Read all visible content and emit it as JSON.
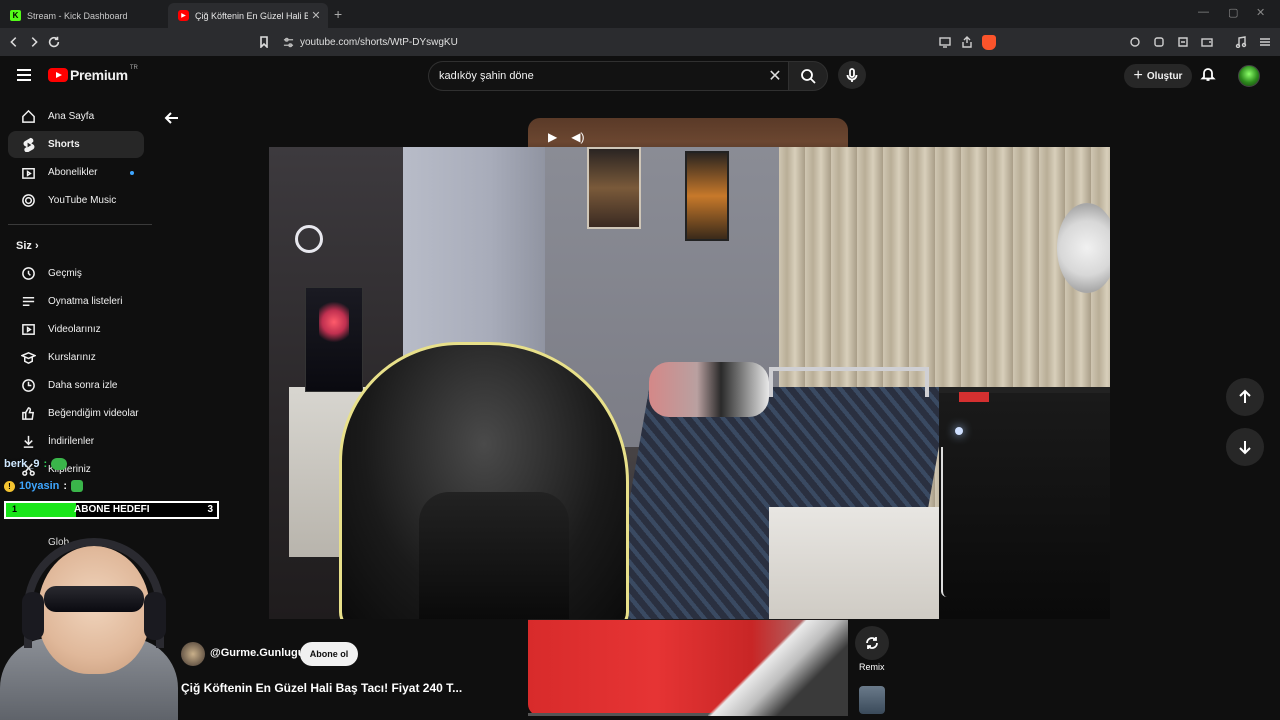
{
  "browser": {
    "tabs": [
      {
        "title": "Stream - Kick Dashboard",
        "favicon": "kick-icon"
      },
      {
        "title": "Çiğ Köftenin En Güzel Hali Baş Taci",
        "favicon": "youtube-icon"
      }
    ],
    "url": "youtube.com/shorts/WtP-DYswgKU"
  },
  "masthead": {
    "logo_text": "Premium",
    "country_code": "TR",
    "search_value": "kadıköy şahin döne",
    "create_label": "Oluştur"
  },
  "sidebar": {
    "main": [
      {
        "label": "Ana Sayfa",
        "icon": "home-icon"
      },
      {
        "label": "Shorts",
        "icon": "shorts-icon",
        "active": true
      },
      {
        "label": "Abonelikler",
        "icon": "subscriptions-icon",
        "new_dot": true
      },
      {
        "label": "YouTube Music",
        "icon": "music-icon"
      }
    ],
    "you_header": "Siz",
    "you": [
      {
        "label": "Geçmiş",
        "icon": "history-icon"
      },
      {
        "label": "Oynatma listeleri",
        "icon": "playlists-icon"
      },
      {
        "label": "Videolarınız",
        "icon": "your-videos-icon"
      },
      {
        "label": "Kurslarınız",
        "icon": "courses-icon"
      },
      {
        "label": "Daha sonra izle",
        "icon": "watch-later-icon"
      },
      {
        "label": "Beğendiğim videolar",
        "icon": "liked-icon"
      },
      {
        "label": "İndirilenler",
        "icon": "download-icon"
      },
      {
        "label": "Klipleriniz",
        "icon": "clips-icon"
      }
    ],
    "subscriptions_partial": [
      "Glob"
    ]
  },
  "short": {
    "channel": "@Gurme.Gunlugu",
    "subscribe_label": "Abone ol",
    "title": "Çiğ Köftenin En Güzel Hali Baş Tacı! Fiyat 240 T...",
    "remix_label": "Remix"
  },
  "stream_overlay": {
    "chat": [
      {
        "user": "berk_9",
        "text": ":"
      },
      {
        "user": "10yasin",
        "text": ":"
      }
    ],
    "goal": {
      "label": "ABONE HEDEFI",
      "current": "1",
      "target": "3",
      "progress": 0.33,
      "color": "#19e619"
    }
  },
  "colors": {
    "brand_red": "#ff0000",
    "accent_blue": "#3ea6ff",
    "kick_green": "#53fc18"
  }
}
